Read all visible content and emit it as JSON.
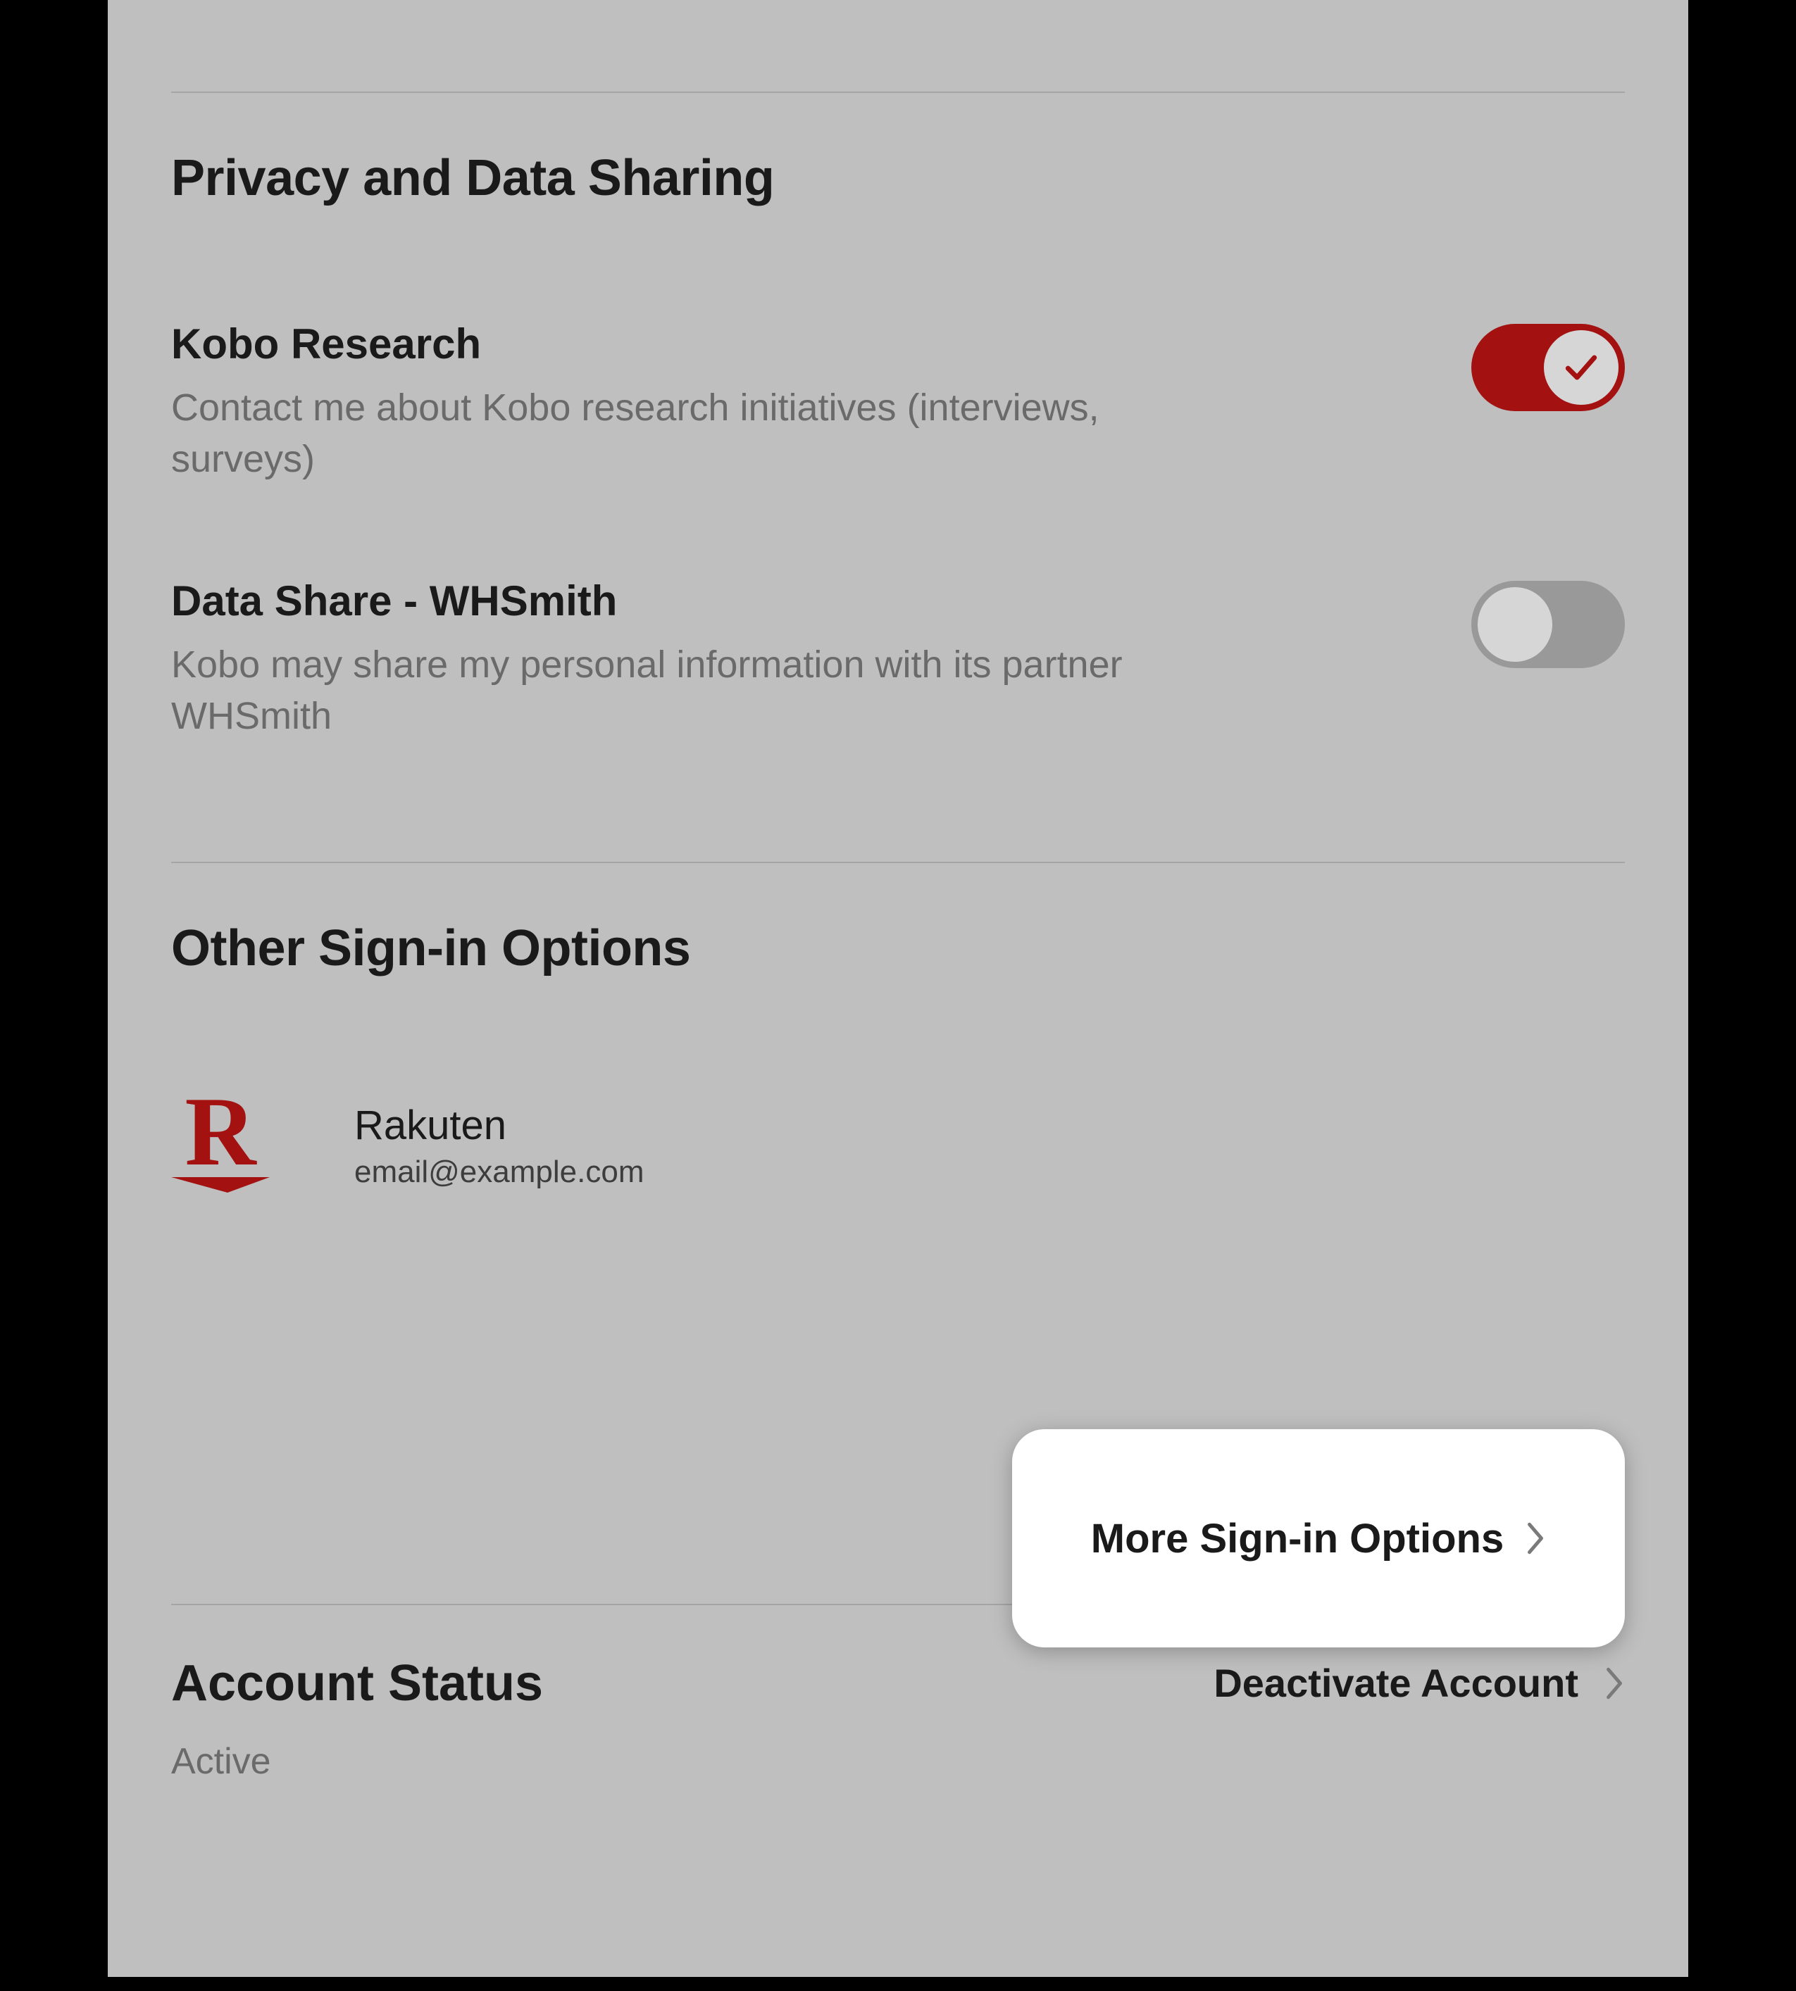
{
  "privacy": {
    "heading": "Privacy and Data Sharing",
    "research": {
      "title": "Kobo Research",
      "desc": "Contact me about Kobo research initiatives (interviews, surveys)",
      "enabled": true
    },
    "dataShare": {
      "title": "Data Share - WHSmith",
      "desc": "Kobo may share my personal information with its partner WHSmith",
      "enabled": false
    }
  },
  "signin": {
    "heading": "Other Sign-in Options",
    "provider": {
      "name": "Rakuten",
      "email": "email@example.com",
      "logoLetter": "R"
    },
    "moreLabel": "More Sign-in Options"
  },
  "account": {
    "heading": "Account Status",
    "deactivateLabel": "Deactivate Account",
    "status": "Active"
  },
  "colors": {
    "accent": "#a31111"
  }
}
